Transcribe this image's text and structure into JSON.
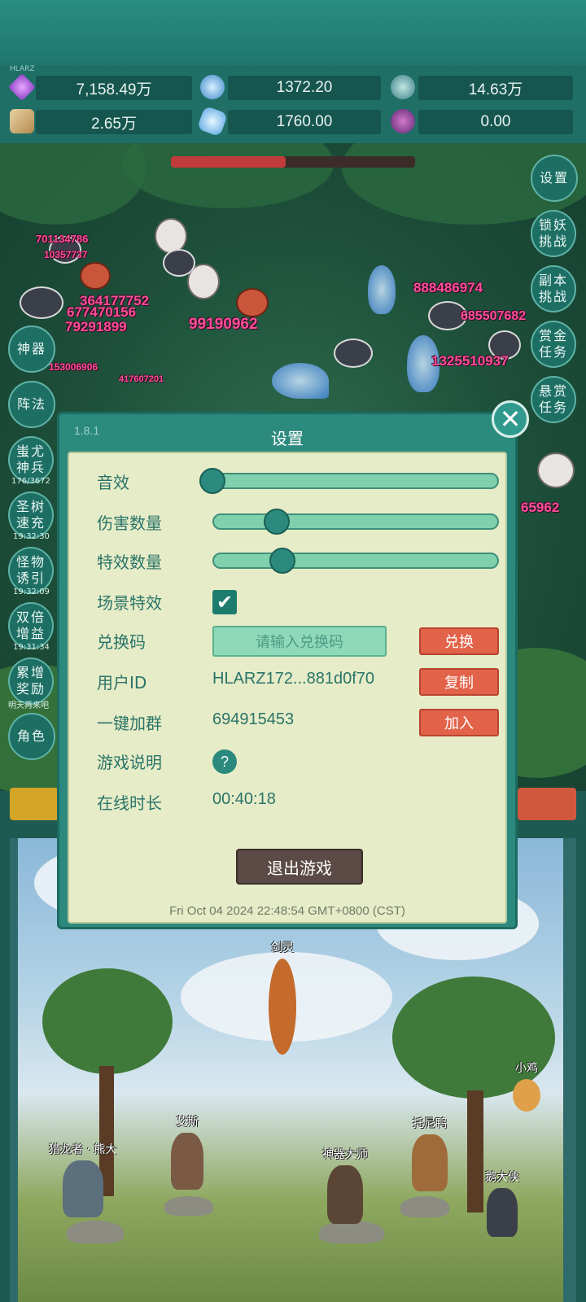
{
  "resources": {
    "tiny_label": "HLARZ",
    "items": [
      {
        "icon": "purple-gem-icon",
        "value": "7,158.49万"
      },
      {
        "icon": "blue-crystal-icon",
        "value": "1372.20"
      },
      {
        "icon": "teal-orb-icon",
        "value": "14.63万"
      },
      {
        "icon": "scroll-icon",
        "value": "2.65万"
      },
      {
        "icon": "ice-shard-icon",
        "value": "1760.00"
      },
      {
        "icon": "purple-potion-icon",
        "value": "0.00"
      }
    ]
  },
  "battle": {
    "damage_numbers": [
      "701134786",
      "10357737",
      "364177752",
      "677470156",
      "79291899",
      "99190962",
      "153006906",
      "417607201",
      "888486974",
      "685507682",
      "1325510937",
      "65962"
    ],
    "boss_hp_fraction": 0.47
  },
  "side_menu": {
    "left": [
      {
        "label": "神器",
        "time": ""
      },
      {
        "label": "阵法",
        "time": ""
      },
      {
        "label": "蚩尤神兵",
        "time": "176/3672"
      },
      {
        "label": "圣树速充",
        "time": "19:32:30"
      },
      {
        "label": "怪物诱引",
        "time": "19:32:09"
      },
      {
        "label": "双倍增益",
        "time": "19:31:34"
      },
      {
        "label": "累增奖励",
        "time": "明天再来吧"
      },
      {
        "label": "角色",
        "time": ""
      }
    ],
    "right": [
      "设置",
      "锁妖挑战",
      "副本挑战",
      "赏金任务",
      "悬赏任务"
    ]
  },
  "settings": {
    "version": "1.8.1",
    "title": "设置",
    "sound_label": "音效",
    "sound_level": 0.0,
    "damage_count_label": "伤害数量",
    "damage_count_level": 0.2,
    "effect_count_label": "特效数量",
    "effect_count_level": 0.22,
    "scene_effect_label": "场景特效",
    "scene_effect_checked": true,
    "redeem_label": "兑换码",
    "redeem_placeholder": "请输入兑换码",
    "redeem_button": "兑换",
    "user_id_label": "用户ID",
    "user_id_value": "HLARZ172...881d0f70",
    "copy_button": "复制",
    "join_group_label": "一键加群",
    "join_group_value": "694915453",
    "join_button": "加入",
    "help_label": "游戏说明",
    "help_icon": "?",
    "online_label": "在线时长",
    "online_value": "00:40:18",
    "quit_button": "退出游戏",
    "timestamp": "Fri Oct 04 2024 22:48:54 GMT+0800 (CST)",
    "close_icon": "✕"
  },
  "scene": {
    "npcs": [
      {
        "name": "剑灵",
        "color": "#c46a2c"
      },
      {
        "name": "艾斯",
        "color": "#7a5a45"
      },
      {
        "name": "猎龙者 · 熊大",
        "color": "#5b6f7c"
      },
      {
        "name": "神器大师",
        "color": "#5b4636"
      },
      {
        "name": "托尼鸭",
        "color": "#a06b3a"
      },
      {
        "name": "小鸡",
        "color": "#e0a04a"
      },
      {
        "name": "鹅大侠",
        "color": "#3a3f4a"
      }
    ]
  }
}
